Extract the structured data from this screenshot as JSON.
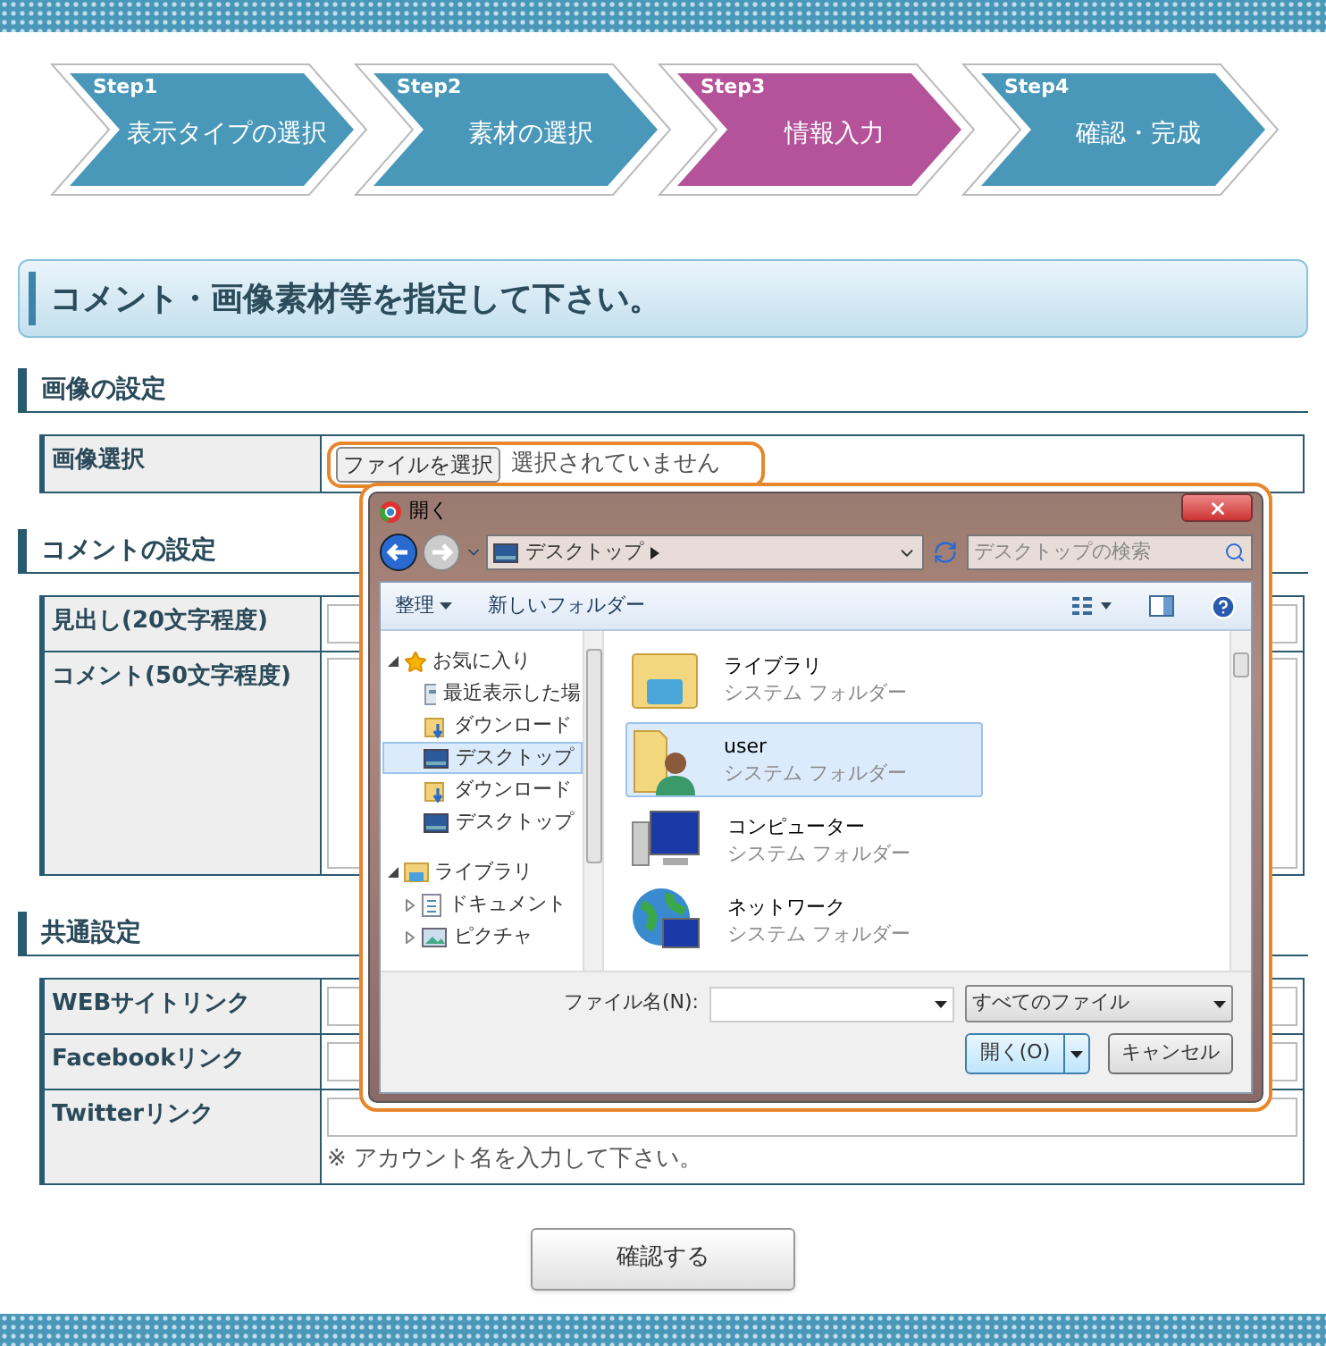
{
  "steps": [
    {
      "label": "Step1",
      "title": "表示タイプの選択",
      "selected": false
    },
    {
      "label": "Step2",
      "title": "素材の選択",
      "selected": false
    },
    {
      "label": "Step3",
      "title": "情報入力",
      "selected": true
    },
    {
      "label": "Step4",
      "title": "確認・完成",
      "selected": false
    }
  ],
  "page_heading": "コメント・画像素材等を指定して下さい。",
  "sections": [
    {
      "title": "画像の設定",
      "rows": [
        {
          "label": "画像選択",
          "kind": "file",
          "button": "ファイルを選択",
          "status": "選択されていません"
        }
      ]
    },
    {
      "title": "コメントの設定",
      "rows": [
        {
          "label": "見出し(20文字程度)",
          "kind": "text"
        },
        {
          "label": "コメント(50文字程度)",
          "kind": "textarea"
        }
      ]
    },
    {
      "title": "共通設定",
      "rows": [
        {
          "label": "WEBサイトリンク",
          "kind": "text"
        },
        {
          "label": "Facebookリンク",
          "kind": "text"
        },
        {
          "label": "Twitterリンク",
          "kind": "text",
          "note": "※ アカウント名を入力して下さい。"
        }
      ]
    }
  ],
  "submit": "確認する",
  "dialog": {
    "title": "開く",
    "address": "デスクトップ",
    "search_placeholder": "デスクトップの検索",
    "toolbar": [
      {
        "label": "整理",
        "kind": "menu"
      },
      {
        "label": "新しいフォルダー",
        "kind": "plain"
      }
    ],
    "nav": [
      {
        "label": "お気に入り",
        "kind": "star",
        "expanded": true,
        "children": [
          {
            "label": "最近表示した場",
            "kind": "recent",
            "selected": false
          },
          {
            "label": "ダウンロード",
            "kind": "download",
            "selected": false
          },
          {
            "label": "デスクトップ",
            "kind": "desktop",
            "selected": true
          },
          {
            "label": "ダウンロード",
            "kind": "download",
            "selected": false
          },
          {
            "label": "デスクトップ",
            "kind": "desktop",
            "selected": false
          }
        ]
      },
      {
        "label": "ライブラリ",
        "kind": "library",
        "expanded": true,
        "children": [
          {
            "label": "ドキュメント",
            "kind": "document",
            "expanded": false,
            "selected": false
          },
          {
            "label": "ピクチャ",
            "kind": "picture",
            "expanded": false,
            "selected": false
          }
        ]
      }
    ],
    "items": [
      {
        "name": "ライブラリ",
        "type": "システム フォルダー",
        "kind": "library",
        "selected": false
      },
      {
        "name": "user",
        "type": "システム フォルダー",
        "kind": "user",
        "selected": true
      },
      {
        "name": "コンピューター",
        "type": "システム フォルダー",
        "kind": "computer",
        "selected": false
      },
      {
        "name": "ネットワーク",
        "type": "システム フォルダー",
        "kind": "network",
        "selected": false
      }
    ],
    "filename_label": "ファイル名(N):",
    "filter": "すべてのファイル",
    "open_button": "開く(O)",
    "cancel_button": "キャンセル"
  }
}
